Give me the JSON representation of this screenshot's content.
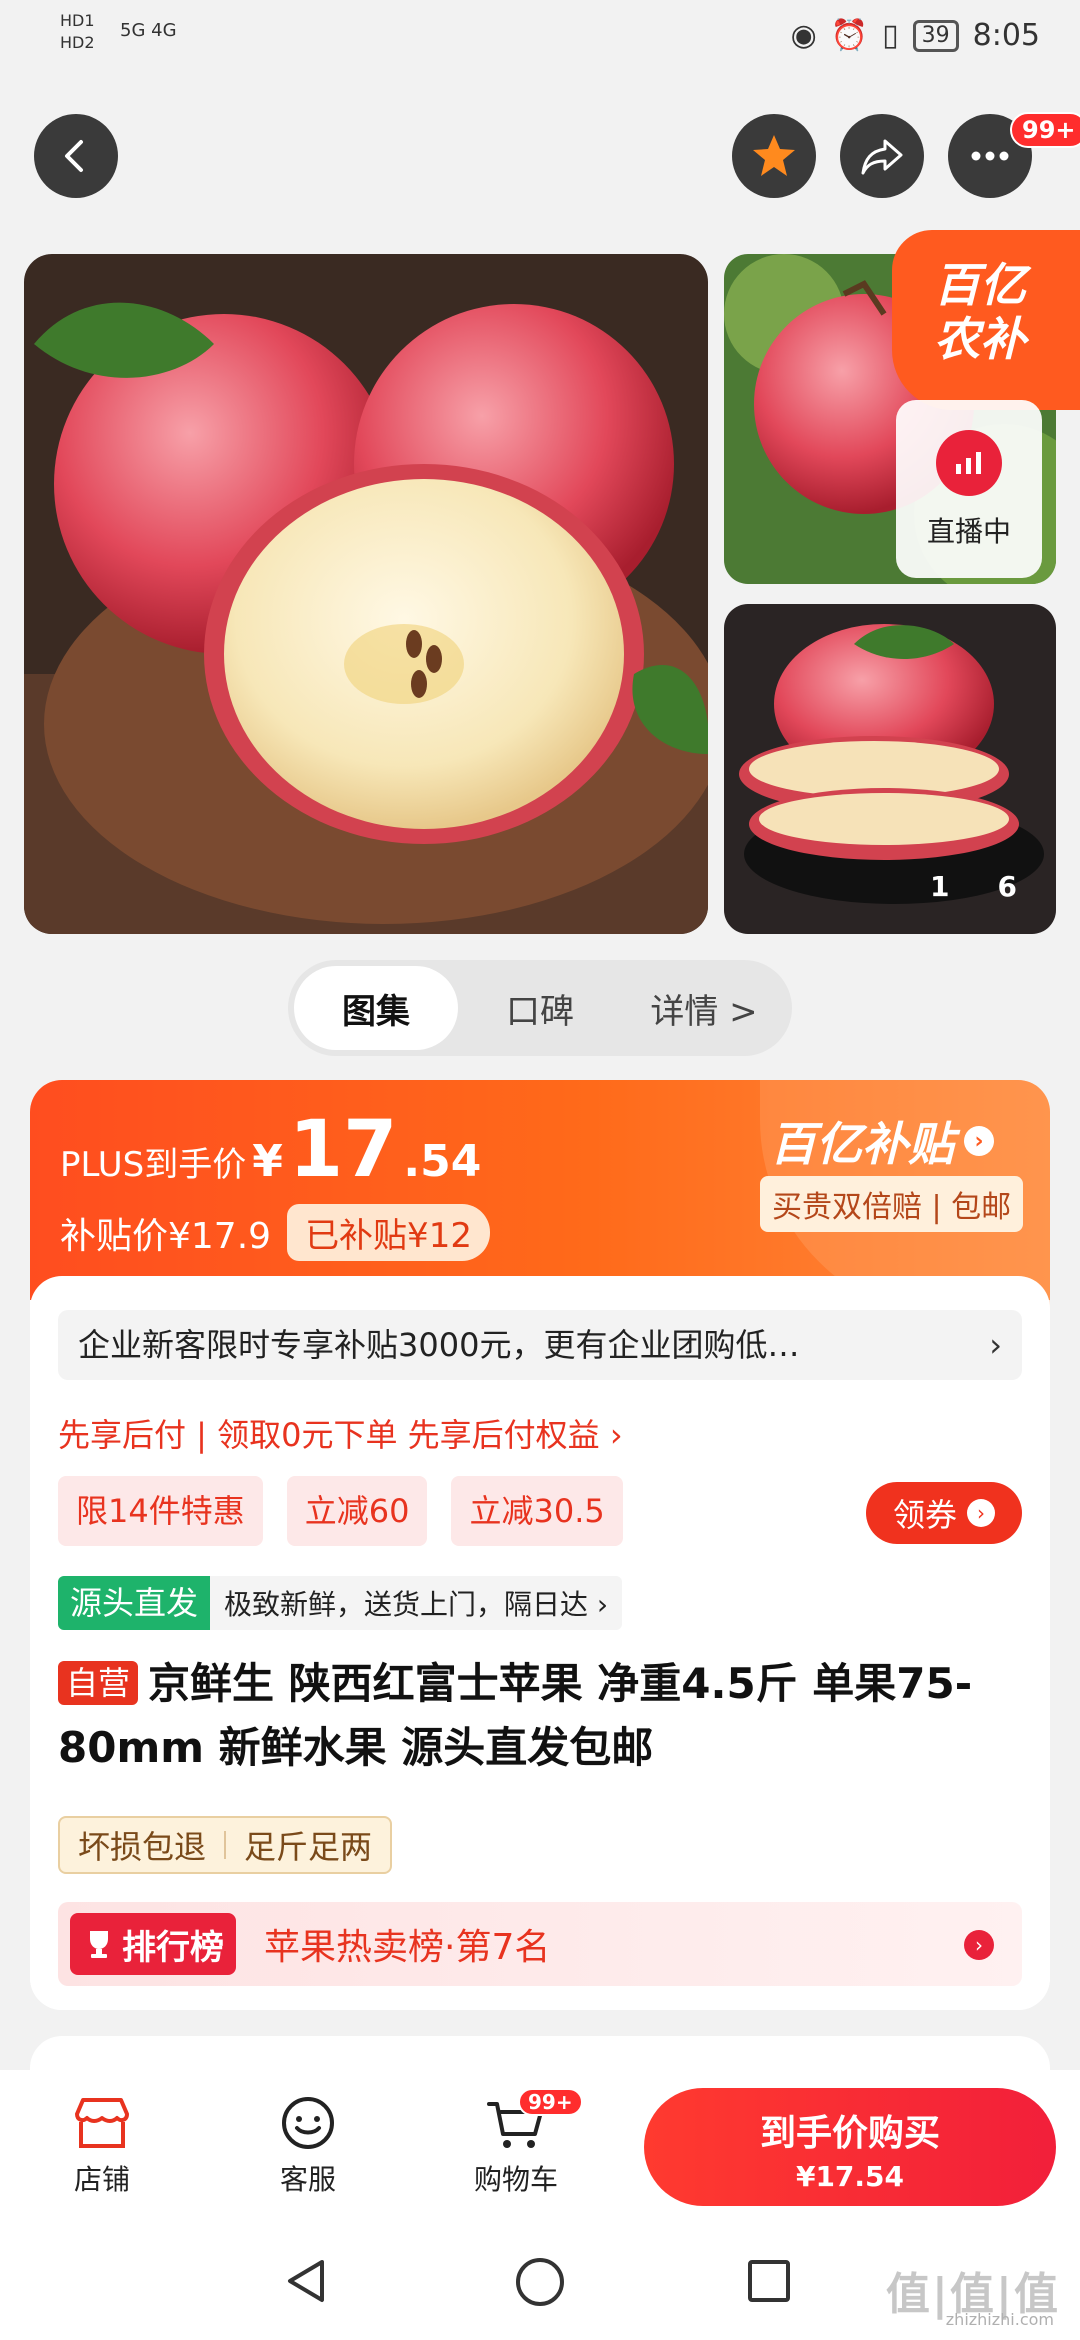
{
  "status_bar": {
    "hd1": "HD1",
    "hd2": "HD2",
    "network": "5G 4G",
    "battery": "39",
    "time": "8:05"
  },
  "top_nav": {
    "more_badge": "99+"
  },
  "gallery": {
    "subsidy_tag": "百亿\n农补",
    "live_label": "直播中",
    "counter_current": "1",
    "counter_total": "6"
  },
  "tabs": [
    {
      "label": "图集",
      "active": true
    },
    {
      "label": "口碑",
      "active": false
    },
    {
      "label": "详情 >",
      "active": false
    }
  ],
  "price": {
    "plus_label": "PLUS到手价",
    "currency": "¥",
    "price_int": "17",
    "price_dec": ".54",
    "sub_label": "补贴价¥17.9",
    "subsidized": "已补贴¥12",
    "brand_logo": "百亿补贴",
    "brand_sub": "买贵双倍赔 | 包邮"
  },
  "info": {
    "enterprise": "企业新客限时专享补贴3000元，更有企业团购低…",
    "paylater": "先享后付 | 领取0元下单 先享后付权益 ›",
    "promos": [
      "限14件特惠",
      "立减60",
      "立减30.5"
    ],
    "coupon_label": "领券",
    "origin_tag": "源头直发",
    "origin_text": "极致新鲜，送货上门，隔日达 ›",
    "self_tag": "自营",
    "title": "京鲜生 陕西红富士苹果 净重4.5斤 单果75-80mm 新鲜水果 源头直发包邮",
    "guarantees": [
      "坏损包退",
      "足斤足两"
    ],
    "rank_tag": "排行榜",
    "rank_text": "苹果热卖榜·第7名"
  },
  "bottom_bar": {
    "store": "店铺",
    "service": "客服",
    "cart": "购物车",
    "cart_badge": "99+",
    "buy_label": "到手价购买",
    "buy_price": "¥17.54"
  },
  "watermark": {
    "main": "值|值|值",
    "sub": "zhizhizhi.com"
  },
  "colors": {
    "accent_red": "#e8331f",
    "orange": "#ff5a1f",
    "green": "#1eb36b"
  }
}
